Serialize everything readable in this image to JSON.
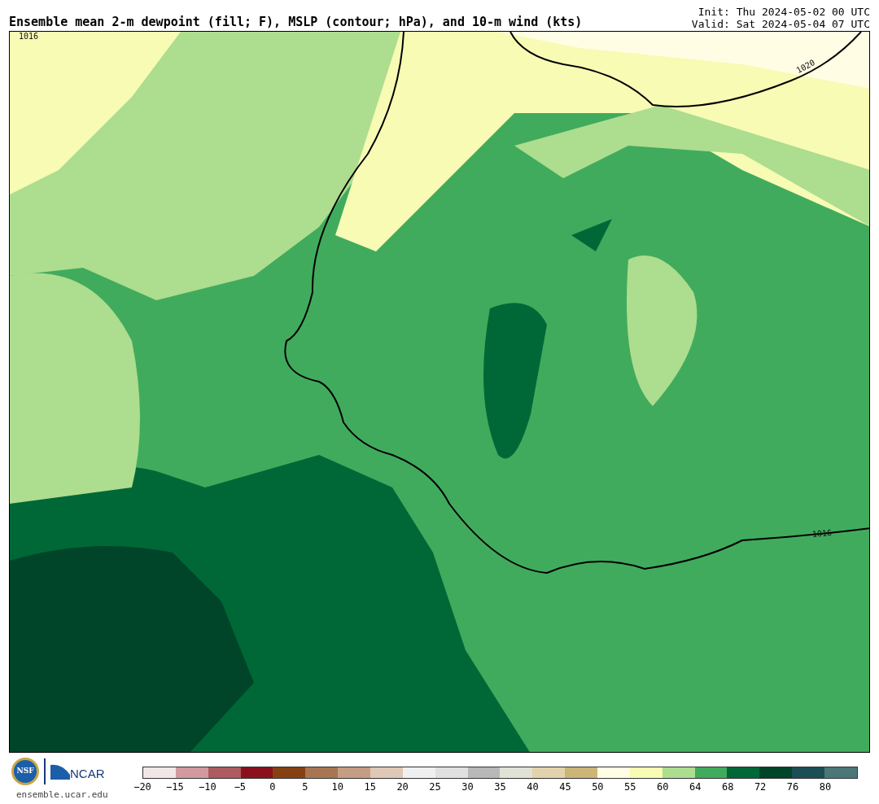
{
  "title": "Ensemble mean 2-m dewpoint (fill; F), MSLP (contour; hPa), and 10-m wind (kts)",
  "run_info": [
    "Init: Thu 2024-05-02 00 UTC",
    "Valid: Sat 2024-05-04 07 UTC"
  ],
  "map": {
    "contour_labels": [
      "1016",
      "1020",
      "1016"
    ]
  },
  "logos": {
    "nsf": "NSF",
    "ncar": "NCAR",
    "url": "ensemble.ucar.edu"
  },
  "colorbar": {
    "segments": [
      {
        "color": "#f2e6e6"
      },
      {
        "color": "#d19a9f"
      },
      {
        "color": "#ad5a60"
      },
      {
        "color": "#8a111c"
      },
      {
        "color": "#864113"
      },
      {
        "color": "#a87552"
      },
      {
        "color": "#c49d83"
      },
      {
        "color": "#e0c8b6"
      },
      {
        "color": "#f0f0f0"
      },
      {
        "color": "#e0e0e0"
      },
      {
        "color": "#b8b8b8"
      },
      {
        "color": "#e0e2d6"
      },
      {
        "color": "#e2d3ac"
      },
      {
        "color": "#ccb677"
      },
      {
        "color": "#fffde3"
      },
      {
        "color": "#f7fbb4"
      },
      {
        "color": "#addd8e"
      },
      {
        "color": "#41ab5d"
      },
      {
        "color": "#006837"
      },
      {
        "color": "#004529"
      },
      {
        "color": "#1c4f55"
      },
      {
        "color": "#4b7778"
      }
    ],
    "ticks": [
      "−20",
      "−15",
      "−10",
      "−5",
      "0",
      "5",
      "10",
      "15",
      "20",
      "25",
      "30",
      "35",
      "40",
      "45",
      "50",
      "55",
      "60",
      "64",
      "68",
      "72",
      "76",
      "80"
    ]
  }
}
